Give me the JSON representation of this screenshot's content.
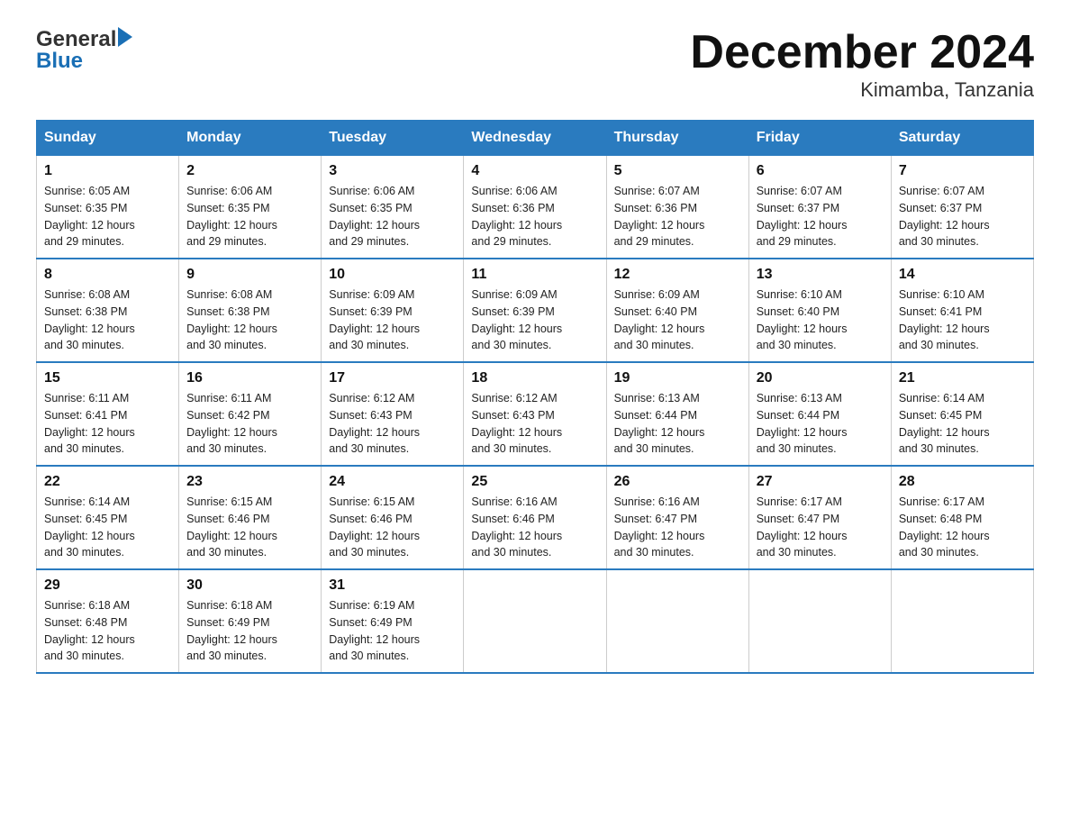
{
  "header": {
    "logo_general": "General",
    "logo_blue": "Blue",
    "title": "December 2024",
    "subtitle": "Kimamba, Tanzania"
  },
  "days_of_week": [
    "Sunday",
    "Monday",
    "Tuesday",
    "Wednesday",
    "Thursday",
    "Friday",
    "Saturday"
  ],
  "weeks": [
    [
      {
        "day": "1",
        "sunrise": "6:05 AM",
        "sunset": "6:35 PM",
        "daylight": "12 hours and 29 minutes."
      },
      {
        "day": "2",
        "sunrise": "6:06 AM",
        "sunset": "6:35 PM",
        "daylight": "12 hours and 29 minutes."
      },
      {
        "day": "3",
        "sunrise": "6:06 AM",
        "sunset": "6:35 PM",
        "daylight": "12 hours and 29 minutes."
      },
      {
        "day": "4",
        "sunrise": "6:06 AM",
        "sunset": "6:36 PM",
        "daylight": "12 hours and 29 minutes."
      },
      {
        "day": "5",
        "sunrise": "6:07 AM",
        "sunset": "6:36 PM",
        "daylight": "12 hours and 29 minutes."
      },
      {
        "day": "6",
        "sunrise": "6:07 AM",
        "sunset": "6:37 PM",
        "daylight": "12 hours and 29 minutes."
      },
      {
        "day": "7",
        "sunrise": "6:07 AM",
        "sunset": "6:37 PM",
        "daylight": "12 hours and 30 minutes."
      }
    ],
    [
      {
        "day": "8",
        "sunrise": "6:08 AM",
        "sunset": "6:38 PM",
        "daylight": "12 hours and 30 minutes."
      },
      {
        "day": "9",
        "sunrise": "6:08 AM",
        "sunset": "6:38 PM",
        "daylight": "12 hours and 30 minutes."
      },
      {
        "day": "10",
        "sunrise": "6:09 AM",
        "sunset": "6:39 PM",
        "daylight": "12 hours and 30 minutes."
      },
      {
        "day": "11",
        "sunrise": "6:09 AM",
        "sunset": "6:39 PM",
        "daylight": "12 hours and 30 minutes."
      },
      {
        "day": "12",
        "sunrise": "6:09 AM",
        "sunset": "6:40 PM",
        "daylight": "12 hours and 30 minutes."
      },
      {
        "day": "13",
        "sunrise": "6:10 AM",
        "sunset": "6:40 PM",
        "daylight": "12 hours and 30 minutes."
      },
      {
        "day": "14",
        "sunrise": "6:10 AM",
        "sunset": "6:41 PM",
        "daylight": "12 hours and 30 minutes."
      }
    ],
    [
      {
        "day": "15",
        "sunrise": "6:11 AM",
        "sunset": "6:41 PM",
        "daylight": "12 hours and 30 minutes."
      },
      {
        "day": "16",
        "sunrise": "6:11 AM",
        "sunset": "6:42 PM",
        "daylight": "12 hours and 30 minutes."
      },
      {
        "day": "17",
        "sunrise": "6:12 AM",
        "sunset": "6:43 PM",
        "daylight": "12 hours and 30 minutes."
      },
      {
        "day": "18",
        "sunrise": "6:12 AM",
        "sunset": "6:43 PM",
        "daylight": "12 hours and 30 minutes."
      },
      {
        "day": "19",
        "sunrise": "6:13 AM",
        "sunset": "6:44 PM",
        "daylight": "12 hours and 30 minutes."
      },
      {
        "day": "20",
        "sunrise": "6:13 AM",
        "sunset": "6:44 PM",
        "daylight": "12 hours and 30 minutes."
      },
      {
        "day": "21",
        "sunrise": "6:14 AM",
        "sunset": "6:45 PM",
        "daylight": "12 hours and 30 minutes."
      }
    ],
    [
      {
        "day": "22",
        "sunrise": "6:14 AM",
        "sunset": "6:45 PM",
        "daylight": "12 hours and 30 minutes."
      },
      {
        "day": "23",
        "sunrise": "6:15 AM",
        "sunset": "6:46 PM",
        "daylight": "12 hours and 30 minutes."
      },
      {
        "day": "24",
        "sunrise": "6:15 AM",
        "sunset": "6:46 PM",
        "daylight": "12 hours and 30 minutes."
      },
      {
        "day": "25",
        "sunrise": "6:16 AM",
        "sunset": "6:46 PM",
        "daylight": "12 hours and 30 minutes."
      },
      {
        "day": "26",
        "sunrise": "6:16 AM",
        "sunset": "6:47 PM",
        "daylight": "12 hours and 30 minutes."
      },
      {
        "day": "27",
        "sunrise": "6:17 AM",
        "sunset": "6:47 PM",
        "daylight": "12 hours and 30 minutes."
      },
      {
        "day": "28",
        "sunrise": "6:17 AM",
        "sunset": "6:48 PM",
        "daylight": "12 hours and 30 minutes."
      }
    ],
    [
      {
        "day": "29",
        "sunrise": "6:18 AM",
        "sunset": "6:48 PM",
        "daylight": "12 hours and 30 minutes."
      },
      {
        "day": "30",
        "sunrise": "6:18 AM",
        "sunset": "6:49 PM",
        "daylight": "12 hours and 30 minutes."
      },
      {
        "day": "31",
        "sunrise": "6:19 AM",
        "sunset": "6:49 PM",
        "daylight": "12 hours and 30 minutes."
      },
      {
        "day": "",
        "sunrise": "",
        "sunset": "",
        "daylight": ""
      },
      {
        "day": "",
        "sunrise": "",
        "sunset": "",
        "daylight": ""
      },
      {
        "day": "",
        "sunrise": "",
        "sunset": "",
        "daylight": ""
      },
      {
        "day": "",
        "sunrise": "",
        "sunset": "",
        "daylight": ""
      }
    ]
  ],
  "labels": {
    "sunrise": "Sunrise:",
    "sunset": "Sunset:",
    "daylight": "Daylight:"
  }
}
